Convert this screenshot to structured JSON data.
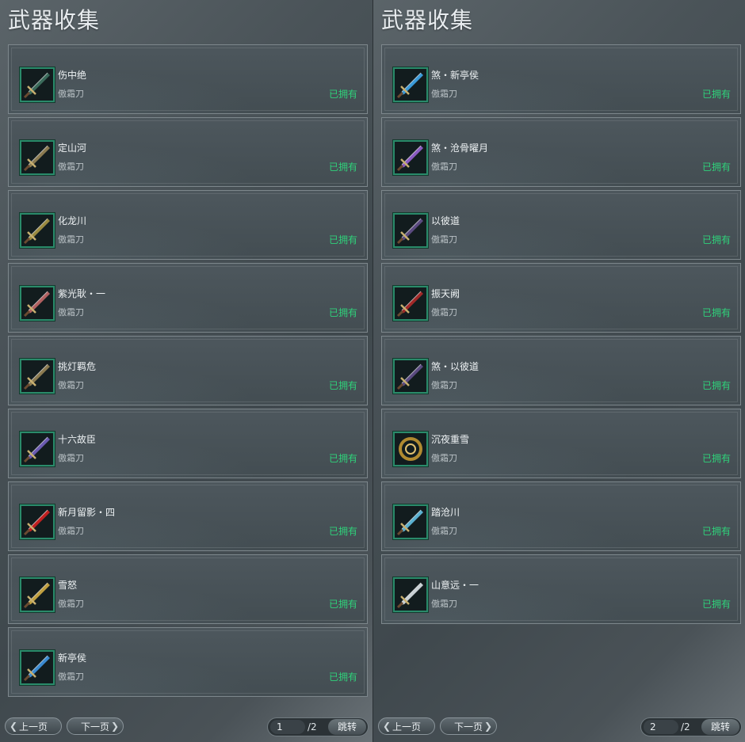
{
  "left": {
    "title": "武器收集",
    "items": [
      {
        "name": "伤中绝",
        "category": "傲霜刀",
        "status": "已拥有",
        "icon": "sword-teal-icon",
        "color": "#3a6a5a"
      },
      {
        "name": "定山河",
        "category": "傲霜刀",
        "status": "已拥有",
        "icon": "blade-cluster-gold-icon",
        "color": "#8a7a50"
      },
      {
        "name": "化龙川",
        "category": "傲霜刀",
        "status": "已拥有",
        "icon": "blade-cluster-gold-icon",
        "color": "#9a8a40"
      },
      {
        "name": "紫光耿・一",
        "category": "傲霜刀",
        "status": "已拥有",
        "icon": "blade-white-red-icon",
        "color": "#b06060"
      },
      {
        "name": "挑灯羁危",
        "category": "傲霜刀",
        "status": "已拥有",
        "icon": "blade-cluster-gold-icon",
        "color": "#8a7a50"
      },
      {
        "name": "十六故臣",
        "category": "傲霜刀",
        "status": "已拥有",
        "icon": "blade-purple-icon",
        "color": "#6a5ab0"
      },
      {
        "name": "新月留影・四",
        "category": "傲霜刀",
        "status": "已拥有",
        "icon": "blade-red-flame-icon",
        "color": "#c02020"
      },
      {
        "name": "雪怒",
        "category": "傲霜刀",
        "status": "已拥有",
        "icon": "blade-gold-icon",
        "color": "#c0a040"
      },
      {
        "name": "新亭侯",
        "category": "傲霜刀",
        "status": "已拥有",
        "icon": "blade-blue-icon",
        "color": "#3a8ad0"
      }
    ],
    "footer": {
      "prev": "上一页",
      "next": "下一页",
      "page": "1",
      "total": "/2",
      "jump": "跳转"
    }
  },
  "right": {
    "title": "武器收集",
    "items": [
      {
        "name": "煞・新亭侯",
        "category": "傲霜刀",
        "status": "已拥有",
        "icon": "blade-blue-icon",
        "color": "#3a9ad8"
      },
      {
        "name": "煞・沧骨曜月",
        "category": "傲霜刀",
        "status": "已拥有",
        "icon": "blade-purple-icon",
        "color": "#8a5ac0"
      },
      {
        "name": "以彼道",
        "category": "傲霜刀",
        "status": "已拥有",
        "icon": "blade-dark-purple-icon",
        "color": "#5a4a80"
      },
      {
        "name": "振天阙",
        "category": "傲霜刀",
        "status": "已拥有",
        "icon": "blade-red-icon",
        "color": "#a02828"
      },
      {
        "name": "煞・以彼道",
        "category": "傲霜刀",
        "status": "已拥有",
        "icon": "blade-dark-purple-icon",
        "color": "#5a4a80"
      },
      {
        "name": "沉夜重雪",
        "category": "傲霜刀",
        "status": "已拥有",
        "icon": "ring-blade-gold-icon",
        "color": "#b08a30"
      },
      {
        "name": "踏沧川",
        "category": "傲霜刀",
        "status": "已拥有",
        "icon": "blade-ice-icon",
        "color": "#5ab0d0"
      },
      {
        "name": "山意远・一",
        "category": "傲霜刀",
        "status": "已拥有",
        "icon": "blade-white-icon",
        "color": "#c8d0d4"
      }
    ],
    "footer": {
      "prev": "上一页",
      "next": "下一页",
      "page": "2",
      "total": "/2",
      "jump": "跳转"
    }
  }
}
